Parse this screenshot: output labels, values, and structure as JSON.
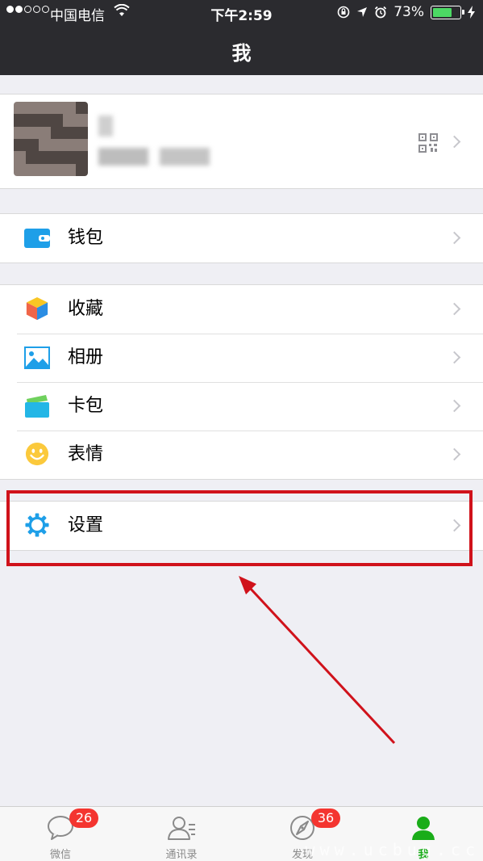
{
  "status_bar": {
    "carrier": "中国电信",
    "time": "下午2:59",
    "battery": "73%",
    "battery_level": 0.73
  },
  "nav": {
    "title": "我"
  },
  "profile": {
    "icon": "qr-code-icon"
  },
  "menu_groups": [
    [
      {
        "label": "钱包",
        "icon": "wallet-icon"
      }
    ],
    [
      {
        "label": "收藏",
        "icon": "favorites-icon"
      },
      {
        "label": "相册",
        "icon": "album-icon"
      },
      {
        "label": "卡包",
        "icon": "card-pack-icon"
      },
      {
        "label": "表情",
        "icon": "sticker-icon"
      }
    ],
    [
      {
        "label": "设置",
        "icon": "settings-icon"
      }
    ]
  ],
  "tabs": [
    {
      "label": "微信",
      "icon": "chats-icon",
      "badge": "26"
    },
    {
      "label": "通讯录",
      "icon": "contacts-icon",
      "badge": ""
    },
    {
      "label": "发现",
      "icon": "discover-icon",
      "badge": "36"
    },
    {
      "label": "我",
      "icon": "me-icon",
      "badge": "",
      "active": true
    }
  ],
  "watermark": "www.ucbug.cc",
  "colors": {
    "accent": "#1aad19",
    "highlight": "#d0121b",
    "badge": "#f43530",
    "nav_bg": "#2b2b2f"
  }
}
